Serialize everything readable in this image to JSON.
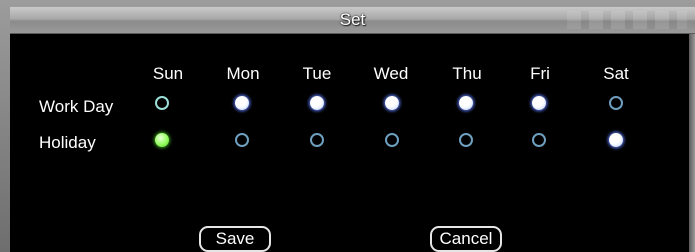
{
  "dialog": {
    "title": "Set"
  },
  "days": [
    "Sun",
    "Mon",
    "Tue",
    "Wed",
    "Thu",
    "Fri",
    "Sat"
  ],
  "rows": [
    {
      "label": "Work Day",
      "selected": [
        false,
        true,
        true,
        true,
        true,
        true,
        false
      ]
    },
    {
      "label": "Holiday",
      "selected": [
        true,
        false,
        false,
        false,
        false,
        false,
        true
      ]
    }
  ],
  "buttons": {
    "save": "Save",
    "cancel": "Cancel"
  },
  "colors": {
    "selected": "#ffffff",
    "selected_highlight": "#9aff66",
    "unselected_ring": "#6f9fbf"
  }
}
